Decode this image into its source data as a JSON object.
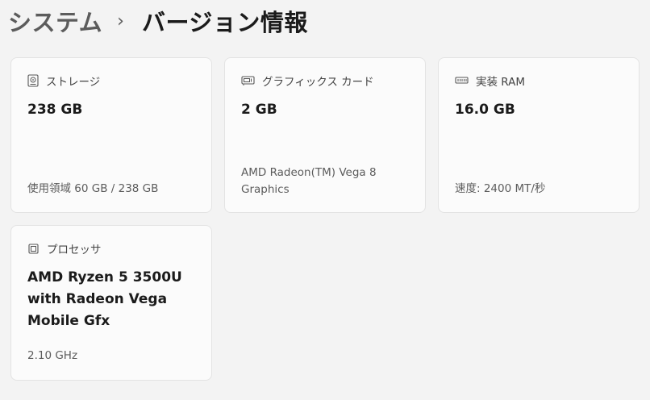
{
  "breadcrumb": {
    "parent": "システム",
    "separator": "›",
    "current": "バージョン情報"
  },
  "cards": {
    "storage": {
      "icon": "hard-drive-icon",
      "label": "ストレージ",
      "value": "238 GB",
      "detail": "使用領域 60 GB / 238 GB"
    },
    "graphics": {
      "icon": "graphics-card-icon",
      "label": "グラフィックス カード",
      "value": "2 GB",
      "detail_line1": "AMD Radeon(TM) Vega 8",
      "detail_line2": "Graphics"
    },
    "ram": {
      "icon": "memory-icon",
      "label": "実装 RAM",
      "value": "16.0 GB",
      "detail": "速度: 2400 MT/秒"
    },
    "processor": {
      "icon": "processor-icon",
      "label": "プロセッサ",
      "value_line1": "AMD Ryzen 5 3500U",
      "value_line2": "with Radeon Vega",
      "value_line3": "Mobile Gfx",
      "detail": "2.10 GHz"
    }
  }
}
